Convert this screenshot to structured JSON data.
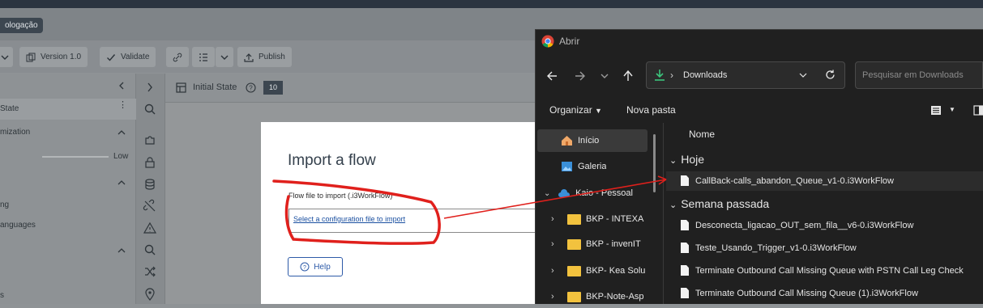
{
  "app": {
    "env_badge": "ologação",
    "toolbar": {
      "version_label": "Version 1.0",
      "validate_label": "Validate",
      "publish_label": "Publish"
    },
    "left_panel": {
      "row1": "State",
      "row2": "mization",
      "row3_value": "Low",
      "row4": "ng",
      "row5": "anguages",
      "row6": "s"
    },
    "canvas_header": {
      "title": "Initial State",
      "badge": "10"
    },
    "modal": {
      "title": "Import a flow",
      "flow_label": "Flow file to import (.i3WorkFlow)",
      "file_link": "Select a configuration file to import",
      "help_label": "Help"
    }
  },
  "dialog": {
    "title": "Abrir",
    "address": "Downloads",
    "search_placeholder": "Pesquisar em Downloads",
    "organize_label": "Organizar",
    "new_folder_label": "Nova pasta",
    "column_name": "Nome",
    "nav": [
      {
        "label": "Início"
      },
      {
        "label": "Galeria"
      },
      {
        "label": "Kaio - Pessoal"
      },
      {
        "label": "BKP - INTEXA"
      },
      {
        "label": "BKP - invenIT"
      },
      {
        "label": "BKP- Kea Solu"
      },
      {
        "label": "BKP-Note-Asp"
      }
    ],
    "groups": {
      "today": "Hoje",
      "last_week": "Semana passada"
    },
    "files_today": [
      "CallBack-calls_abandon_Queue_v1-0.i3WorkFlow"
    ],
    "files_last_week": [
      "Desconecta_ligacao_OUT_sem_fila__v6-0.i3WorkFlow",
      "Teste_Usando_Trigger_v1-0.i3WorkFlow",
      "Terminate Outbound Call Missing Queue with PSTN Call Leg Check",
      "Terminate Outbound Call Missing Queue (1).i3WorkFlow"
    ]
  },
  "colors": {
    "annotation_red": "#e0201c",
    "link_blue": "#1a4fa0",
    "folder_yellow": "#f2c23e",
    "download_green": "#3cc47c"
  }
}
